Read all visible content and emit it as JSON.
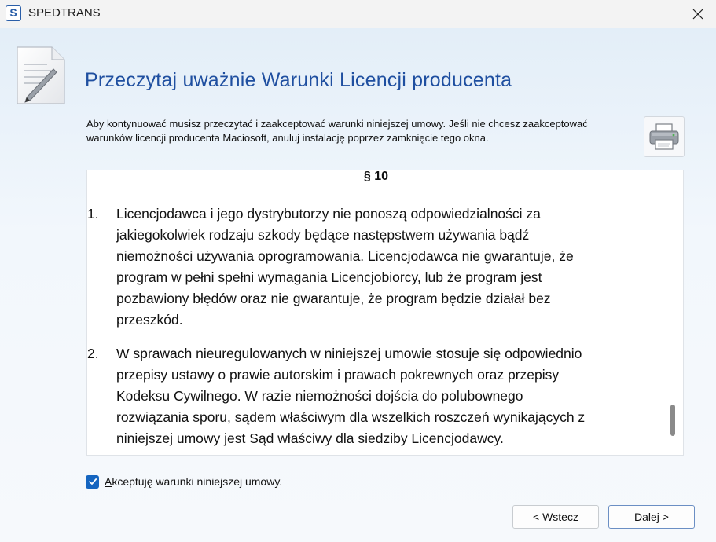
{
  "window": {
    "app_icon_letter": "S",
    "title": "SPEDTRANS"
  },
  "header": {
    "heading": "Przeczytaj uważnie Warunki Licencji producenta",
    "intro": "Aby kontynuować musisz przeczytać i zaakceptować warunki niniejszej umowy. Jeśli nie chcesz zaakceptować warunków licencji producenta Maciosoft, anuluj instalację poprzez zamknięcie tego okna."
  },
  "license": {
    "section": "§ 10",
    "clauses": [
      {
        "number": "1.",
        "lines": [
          "Licencjodawca i jego dystrybutorzy nie ponoszą odpowiedzialności za",
          "jakiegokolwiek rodzaju szkody będące następstwem używania bądź",
          "niemożności używania oprogramowania. Licencjodawca nie gwarantuje, że",
          "program w pełni spełni wymagania Licencjobiorcy, lub że program jest",
          "pozbawiony błędów oraz nie gwarantuje, że program będzie działał bez",
          "przeszkód."
        ]
      },
      {
        "number": "2.",
        "lines": [
          "W sprawach nieuregulowanych w niniejszej umowie stosuje się odpowiednio",
          "przepisy ustawy o prawie autorskim i prawach pokrewnych oraz przepisy",
          "Kodeksu Cywilnego. W razie niemożności dojścia do polubownego",
          "rozwiązania sporu, sądem właściwym dla wszelkich roszczeń wynikających z",
          "niniejszej umowy jest Sąd właściwy dla siedziby Licencjodawcy."
        ]
      }
    ]
  },
  "accept": {
    "checked": true,
    "label_first": "A",
    "label_rest": "kceptuję warunki niniejszej umowy."
  },
  "buttons": {
    "back": "< Wstecz",
    "next": "Dalej >"
  },
  "icons": {
    "app": "app-logo-icon",
    "close": "close-icon",
    "document": "document-pen-icon",
    "print": "printer-icon",
    "check": "checkmark-icon"
  },
  "colors": {
    "heading": "#1f4fa0",
    "checkbox": "#1565c0"
  }
}
